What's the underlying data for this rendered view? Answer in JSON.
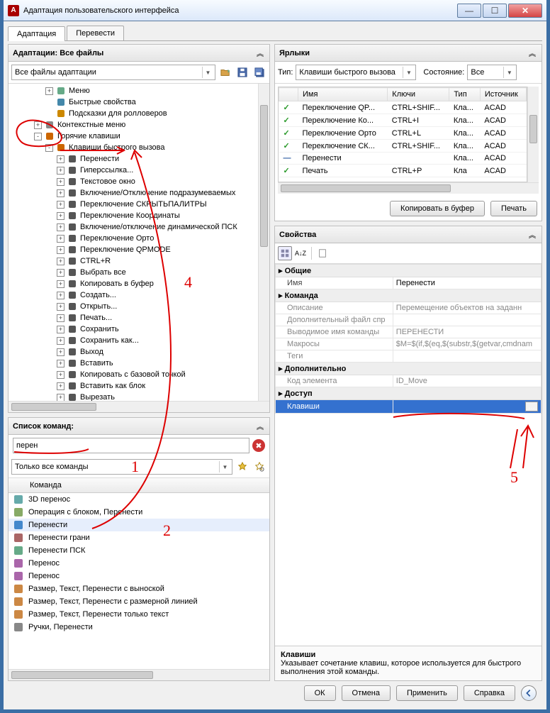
{
  "window_title": "Адаптация пользовательского интерфейса",
  "tabs": {
    "adapt": "Адаптация",
    "translate": "Перевести"
  },
  "adapt_panel": {
    "title": "Адаптации: Все файлы",
    "combo": "Все файлы адаптации"
  },
  "tree": [
    {
      "indent": 3,
      "toggle": "+",
      "icon": "menu",
      "label": "Меню"
    },
    {
      "indent": 3,
      "toggle": " ",
      "icon": "props",
      "label": "Быстрые свойства"
    },
    {
      "indent": 3,
      "toggle": " ",
      "icon": "tip",
      "label": "Подсказки для ролловеров"
    },
    {
      "indent": 2,
      "toggle": "+",
      "icon": "ctx",
      "label": "Контекстные меню"
    },
    {
      "indent": 2,
      "toggle": "-",
      "icon": "kb",
      "label": "Горячие клавиши"
    },
    {
      "indent": 3,
      "toggle": "-",
      "icon": "kb",
      "label": "Клавиши быстрого вызова"
    },
    {
      "indent": 4,
      "toggle": "+",
      "icon": "cmd",
      "label": "Перенести"
    },
    {
      "indent": 4,
      "toggle": "+",
      "icon": "cmd",
      "label": "Гиперссылка..."
    },
    {
      "indent": 4,
      "toggle": "+",
      "icon": "cmd",
      "label": "Текстовое окно"
    },
    {
      "indent": 4,
      "toggle": "+",
      "icon": "cmd",
      "label": "Включение/Отключение подразумеваемых"
    },
    {
      "indent": 4,
      "toggle": "+",
      "icon": "cmd",
      "label": "Переключение СКРЫТЬПАЛИТРЫ"
    },
    {
      "indent": 4,
      "toggle": "+",
      "icon": "cmd",
      "label": "Переключение Координаты"
    },
    {
      "indent": 4,
      "toggle": "+",
      "icon": "cmd",
      "label": "Включение/отключение динамической ПСК"
    },
    {
      "indent": 4,
      "toggle": "+",
      "icon": "cmd",
      "label": "Переключение Орто"
    },
    {
      "indent": 4,
      "toggle": "+",
      "icon": "cmd",
      "label": "Переключение QPMODE"
    },
    {
      "indent": 4,
      "toggle": "+",
      "icon": "cmd",
      "label": "CTRL+R"
    },
    {
      "indent": 4,
      "toggle": "+",
      "icon": "cmd",
      "label": "Выбрать все"
    },
    {
      "indent": 4,
      "toggle": "+",
      "icon": "cmd",
      "label": "Копировать в буфер"
    },
    {
      "indent": 4,
      "toggle": "+",
      "icon": "cmd",
      "label": "Создать..."
    },
    {
      "indent": 4,
      "toggle": "+",
      "icon": "cmd",
      "label": "Открыть..."
    },
    {
      "indent": 4,
      "toggle": "+",
      "icon": "cmd",
      "label": "Печать..."
    },
    {
      "indent": 4,
      "toggle": "+",
      "icon": "cmd",
      "label": "Сохранить"
    },
    {
      "indent": 4,
      "toggle": "+",
      "icon": "cmd",
      "label": "Сохранить как..."
    },
    {
      "indent": 4,
      "toggle": "+",
      "icon": "cmd",
      "label": "Выход"
    },
    {
      "indent": 4,
      "toggle": "+",
      "icon": "cmd",
      "label": "Вставить"
    },
    {
      "indent": 4,
      "toggle": "+",
      "icon": "cmd",
      "label": "Копировать с базовой точкой"
    },
    {
      "indent": 4,
      "toggle": "+",
      "icon": "cmd",
      "label": "Вставить как блок"
    },
    {
      "indent": 4,
      "toggle": "+",
      "icon": "cmd",
      "label": "Вырезать"
    }
  ],
  "cmd_panel": {
    "title": "Список команд:",
    "search": "перен",
    "filter": "Только все команды",
    "col": "Команда"
  },
  "cmd_list": [
    "3D перенос",
    "Операция с блоком, Перенести",
    "Перенести",
    "Перенести грани",
    "Перенести ПСК",
    "Перенос",
    "Перенос",
    "Размер, Текст, Перенести с выноской",
    "Размер, Текст, Перенести с размерной линией",
    "Размер, Текст, Перенести только текст",
    "Ручки, Перенести"
  ],
  "shortcuts_panel": {
    "title": "Ярлыки",
    "type_lbl": "Тип:",
    "type_val": "Клавиши быстрого вызова",
    "state_lbl": "Состояние:",
    "state_val": "Все",
    "cols": {
      "name": "Имя",
      "keys": "Ключи",
      "type": "Тип",
      "src": "Источник"
    },
    "rows": [
      {
        "ok": true,
        "name": "Переключение QP...",
        "keys": "CTRL+SHIF...",
        "type": "Кла...",
        "src": "ACAD"
      },
      {
        "ok": true,
        "name": "Переключение Ко...",
        "keys": "CTRL+I",
        "type": "Кла...",
        "src": "ACAD"
      },
      {
        "ok": true,
        "name": "Переключение Орто",
        "keys": "CTRL+L",
        "type": "Кла...",
        "src": "ACAD"
      },
      {
        "ok": true,
        "name": "Переключение СК...",
        "keys": "CTRL+SHIF...",
        "type": "Кла...",
        "src": "ACAD"
      },
      {
        "ok": false,
        "name": "Перенести",
        "keys": "",
        "type": "Кла...",
        "src": "ACAD"
      },
      {
        "ok": true,
        "name": "Печать",
        "keys": "CTRL+P",
        "type": "Кла",
        "src": "ACAD"
      }
    ],
    "copy_btn": "Копировать в буфер",
    "print_btn": "Печать"
  },
  "props_panel": {
    "title": "Свойства",
    "cats": {
      "general": "Общие",
      "command": "Команда",
      "extra": "Дополнительно",
      "access": "Доступ"
    },
    "rows": {
      "name_lbl": "Имя",
      "name_val": "Перенести",
      "desc_lbl": "Описание",
      "desc_val": "Перемещение объектов на заданн",
      "addfile_lbl": "Дополнительный файл спр",
      "addfile_val": "",
      "dispname_lbl": "Выводимое имя команды",
      "dispname_val": "ПЕРЕНЕСТИ",
      "macro_lbl": "Макросы",
      "macro_val": "$M=$(if,$(eq,$(substr,$(getvar,cmdnam",
      "tags_lbl": "Теги",
      "tags_val": "",
      "elid_lbl": "Код элемента",
      "elid_val": "ID_Move",
      "keys_lbl": "Клавиши",
      "keys_val": ""
    },
    "help_title": "Клавиши",
    "help_text": "Указывает сочетание клавиш, которое используется для быстрого выполнения этой команды."
  },
  "annotations": {
    "n1": "1",
    "n2": "2",
    "n4": "4",
    "n5": "5"
  },
  "footer": {
    "ok": "ОК",
    "cancel": "Отмена",
    "apply": "Применить",
    "help": "Справка"
  }
}
